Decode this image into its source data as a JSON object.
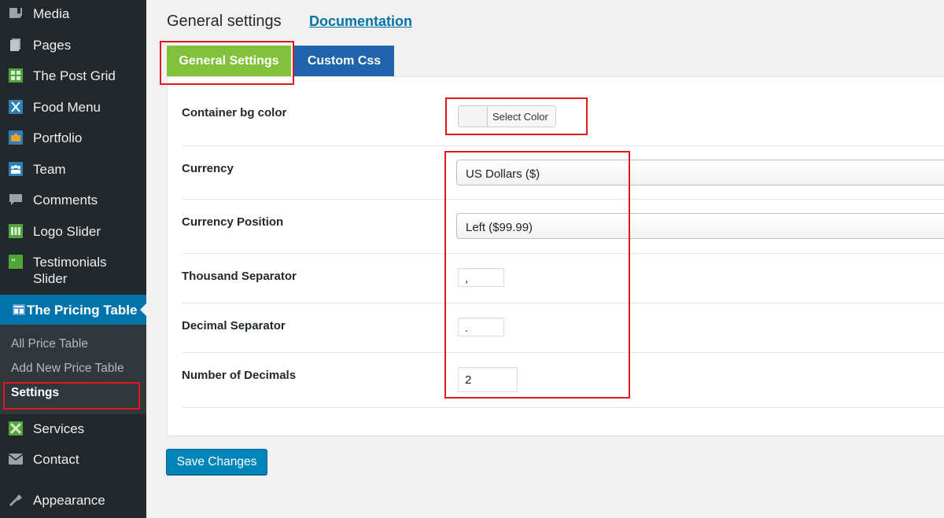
{
  "sidebar": {
    "items": [
      {
        "label": "Media",
        "icon": "media-icon"
      },
      {
        "label": "Pages",
        "icon": "pages-icon"
      },
      {
        "label": "The Post Grid",
        "icon": "post-grid-icon"
      },
      {
        "label": "Food Menu",
        "icon": "food-menu-icon"
      },
      {
        "label": "Portfolio",
        "icon": "portfolio-icon"
      },
      {
        "label": "Team",
        "icon": "team-icon"
      },
      {
        "label": "Comments",
        "icon": "comments-icon"
      },
      {
        "label": "Logo Slider",
        "icon": "logo-slider-icon"
      },
      {
        "label": "Testimonials Slider",
        "icon": "testimonials-icon"
      }
    ],
    "active": {
      "label": "The Pricing Table",
      "icon": "pricing-table-icon"
    },
    "submenu": [
      {
        "label": "All Price Table"
      },
      {
        "label": "Add New Price Table"
      },
      {
        "label": "Settings"
      }
    ],
    "bottom_items": [
      {
        "label": "Services",
        "icon": "services-icon"
      },
      {
        "label": "Contact",
        "icon": "contact-icon"
      },
      {
        "label": "Appearance",
        "icon": "appearance-icon"
      }
    ]
  },
  "header": {
    "title": "General settings",
    "doc_link": "Documentation"
  },
  "tabs": [
    {
      "label": "General Settings"
    },
    {
      "label": "Custom Css"
    }
  ],
  "fields": {
    "container_bg": {
      "label": "Container bg color",
      "button": "Select Color"
    },
    "currency": {
      "label": "Currency",
      "value": "US Dollars ($)"
    },
    "currency_position": {
      "label": "Currency Position",
      "value": "Left ($99.99)"
    },
    "thousand_sep": {
      "label": "Thousand Separator",
      "value": ","
    },
    "decimal_sep": {
      "label": "Decimal Separator",
      "value": "."
    },
    "num_decimals": {
      "label": "Number of Decimals",
      "value": "2"
    }
  },
  "save_label": "Save Changes",
  "colors": {
    "sidebar_bg": "#23282d",
    "active_bg": "#0073aa",
    "tab_active": "#81c13b",
    "tab_inactive": "#1e63ac",
    "button_bg": "#0085ba",
    "highlight": "#e1181f"
  }
}
